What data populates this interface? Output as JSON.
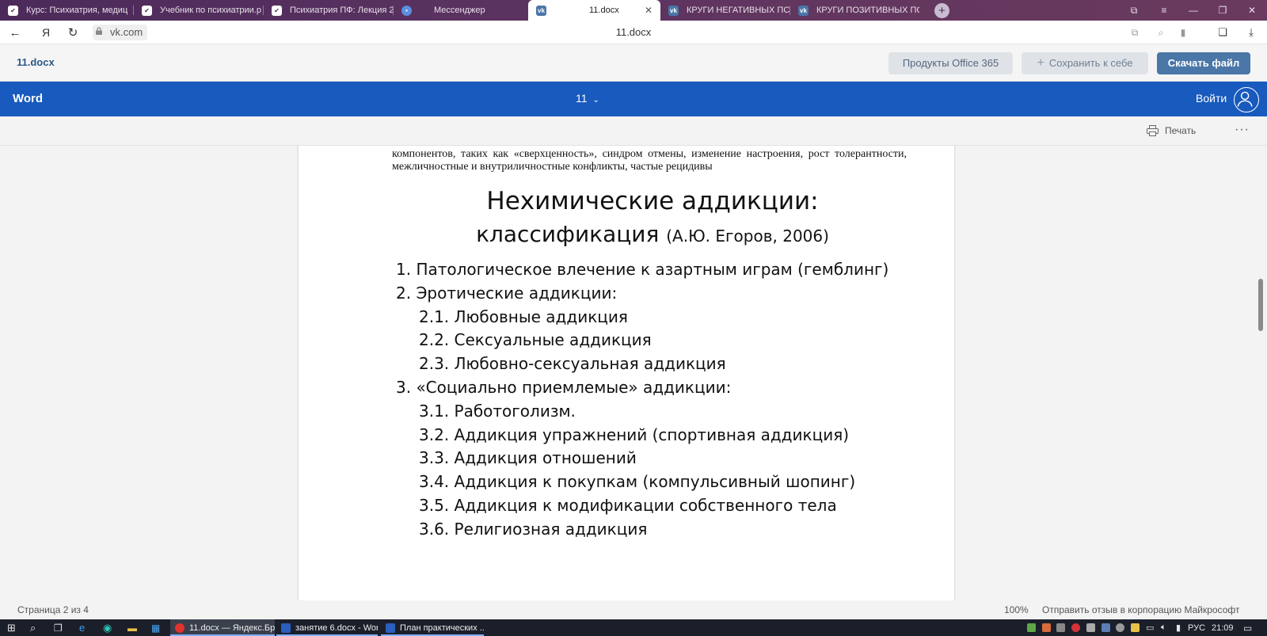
{
  "browser": {
    "tabs": [
      {
        "label": "Курс: Психиатрия, медиц"
      },
      {
        "label": "Учебник по психиатрии.р"
      },
      {
        "label": "Психиатрия ПФ: Лекция 2"
      },
      {
        "label": "Мессенджер"
      },
      {
        "label": "11.docx"
      },
      {
        "label": "КРУГИ НЕГАТИВНЫХ ПСИ"
      },
      {
        "label": "КРУГИ ПОЗИТИВНЫХ ПСИ"
      }
    ],
    "new_tab": "+",
    "domain": "vk.com",
    "page_title": "11.docx",
    "yandex_glyph": "Я"
  },
  "vk": {
    "doc_name": "11.docx",
    "office_label": "Продукты Office 365",
    "save_label": "Сохранить к себе",
    "download_label": "Скачать файл"
  },
  "word": {
    "app_label": "Word",
    "doc_selector": "11",
    "signin_label": "Войти",
    "print_label": "Печать",
    "more_label": "···"
  },
  "document": {
    "continued_text": "компонентов, таких как «сверхценность», синдром отмены, изменение настроения, рост толерантности, межличностные и внутриличностные конфликты, частые рецидивы",
    "heading_line1": "Нехимические аддикции:",
    "heading_line2": "классификация",
    "heading_ref": "(А.Ю. Егоров, 2006)",
    "items": [
      {
        "text": "1. Патологическое влечение к азартным играм (гемблинг)",
        "level": 1
      },
      {
        "text": "2. Эротические аддикции:",
        "level": 1
      },
      {
        "text": "2.1. Любовные аддикция",
        "level": 2
      },
      {
        "text": "2.2. Сексуальные аддикция",
        "level": 2
      },
      {
        "text": "2.3. Любовно-сексуальная аддикция",
        "level": 2
      },
      {
        "text": "3. «Социально приемлемые» аддикции:",
        "level": 1
      },
      {
        "text": "3.1. Работоголизм.",
        "level": 2
      },
      {
        "text": "3.2. Аддикция упражнений (спортивная аддикция)",
        "level": 2
      },
      {
        "text": "3.3. Аддикция отношений",
        "level": 2
      },
      {
        "text": "3.4. Аддикция к покупкам (компульсивный шопинг)",
        "level": 2
      },
      {
        "text": "3.5. Аддикция к модификации собственного тела",
        "level": 2
      },
      {
        "text": "3.6. Религиозная аддикция",
        "level": 2
      }
    ]
  },
  "status": {
    "page_info": "Страница 2 из 4",
    "zoom": "100%",
    "feedback": "Отправить отзыв в корпорацию Майкрософт"
  },
  "taskbar": {
    "apps": [
      {
        "label": "11.docx — Яндекс.Бр..."
      },
      {
        "label": "занятие 6.docx - Word"
      },
      {
        "label": "План практических ..."
      }
    ],
    "lang": "РУС",
    "time": "21:09"
  },
  "colors": {
    "word_blue": "#185abd",
    "vk_blue": "#4a76a8",
    "tab_bar": "#5b3360"
  }
}
